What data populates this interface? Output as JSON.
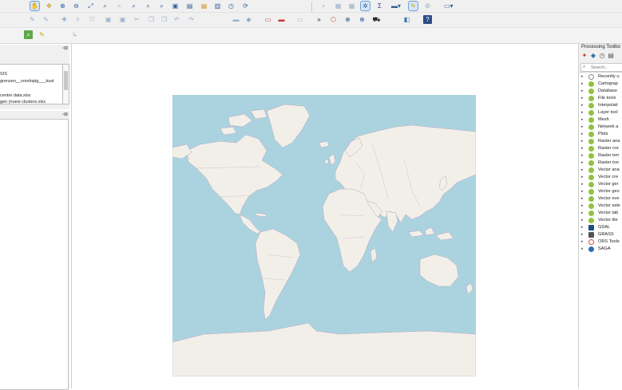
{
  "browser_panel": {
    "items": [
      "SIS",
      "grenzen__voorlopig___kust",
      "",
      "centre data.xlsx",
      "gen (nuew clusters.xlsx"
    ]
  },
  "toolbox": {
    "title": "Processing Toolbo",
    "search_placeholder": "Search...",
    "items": [
      {
        "label": "Recently u",
        "icon": "clock-icon"
      },
      {
        "label": "Cartograp",
        "icon": "qgis-icon"
      },
      {
        "label": "Database",
        "icon": "qgis-icon"
      },
      {
        "label": "File tools",
        "icon": "qgis-icon"
      },
      {
        "label": "Interpolati",
        "icon": "qgis-icon"
      },
      {
        "label": "Layer tool",
        "icon": "qgis-icon"
      },
      {
        "label": "Mesh",
        "icon": "qgis-icon"
      },
      {
        "label": "Network a",
        "icon": "qgis-icon"
      },
      {
        "label": "Plots",
        "icon": "qgis-icon"
      },
      {
        "label": "Raster ana",
        "icon": "qgis-icon"
      },
      {
        "label": "Raster cre",
        "icon": "qgis-icon"
      },
      {
        "label": "Raster terr",
        "icon": "qgis-icon"
      },
      {
        "label": "Raster too",
        "icon": "qgis-icon"
      },
      {
        "label": "Vector ana",
        "icon": "qgis-icon"
      },
      {
        "label": "Vector cre",
        "icon": "qgis-icon"
      },
      {
        "label": "Vector ger",
        "icon": "qgis-icon"
      },
      {
        "label": "Vector geo",
        "icon": "qgis-icon"
      },
      {
        "label": "Vector ove",
        "icon": "qgis-icon"
      },
      {
        "label": "Vector sele",
        "icon": "qgis-icon"
      },
      {
        "label": "Vector tab",
        "icon": "qgis-icon"
      },
      {
        "label": "Vector tile",
        "icon": "qgis-icon"
      },
      {
        "label": "GDAL",
        "icon": "gdal-icon"
      },
      {
        "label": "GRASS",
        "icon": "grass-icon"
      },
      {
        "label": "ORS Tools",
        "icon": "ors-icon"
      },
      {
        "label": "SAGA",
        "icon": "saga-icon"
      }
    ]
  },
  "colors": {
    "ocean": "#aad3df",
    "land": "#f2efe9",
    "border": "#b9a7c0",
    "qgis_green": "#8fc43f"
  }
}
